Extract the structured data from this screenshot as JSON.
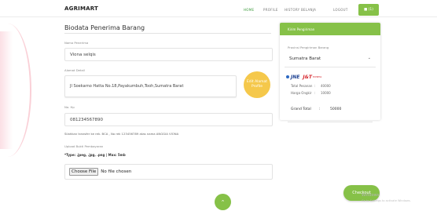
{
  "nav": {
    "brand": "AGRIMART",
    "links": [
      "HOME",
      "PROFILE",
      "HISTORY BELANJA",
      "LOGOUT"
    ],
    "cart_label": "■ (1)"
  },
  "form": {
    "title": "Biodata Penerima Barang",
    "name_label": "Nama Penerima",
    "name_value": "Viona selqis",
    "address_label": "Alamat Detail",
    "address_value": "Jl Soekarno Hatta No.18,Payakumbuh,Tooh,Sumatra Barat",
    "edit_button": "Edit Alamat Profile",
    "hp_label": "No. Hp",
    "hp_value": "081234567890",
    "transfer_text": "Silahkan transfer ke rek. BCA , No rek 123456789 atas nama ANGGIA VIONA",
    "upload_label": "Upload Bukti Pembayaran",
    "file_types": "*Type: .jpeg, .jpg, .png | Max: 5mb",
    "choose_file": "Choose File",
    "no_file": "No file chosen"
  },
  "card": {
    "header": "Kirim Pengiriman",
    "province_label": "Provinsi Pengiriman Barang",
    "province_value": "Sumatra Barat",
    "courier_jne": "JNE",
    "courier_jnt": "J&T",
    "courier_jnt_sub": "EXPRESS",
    "rows": [
      {
        "label": "Total Pesanan",
        "value": "40000"
      },
      {
        "label": "Harga Ongkir",
        "value": "10000"
      }
    ],
    "total_label": "Grand Total",
    "total_value": "50000"
  },
  "actions": {
    "checkout": "Checkout",
    "scroll_top": "⌃"
  },
  "watermark": {
    "title": "Windows",
    "sub": "Go to Settings to activate Windows."
  }
}
